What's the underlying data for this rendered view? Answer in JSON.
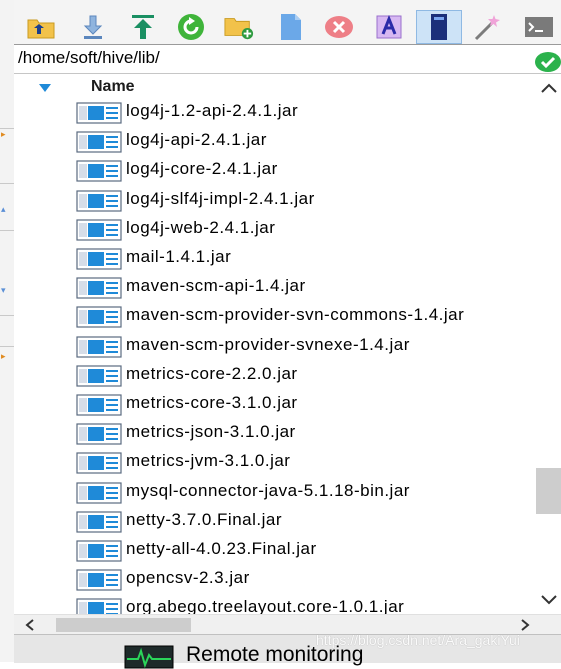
{
  "toolbar": {
    "buttons": [
      {
        "name": "parent-folder-icon"
      },
      {
        "name": "download-icon"
      },
      {
        "name": "upload-icon"
      },
      {
        "name": "refresh-icon"
      },
      {
        "name": "new-folder-icon"
      },
      {
        "name": "new-file-icon"
      },
      {
        "name": "delete-icon"
      },
      {
        "name": "rename-icon"
      },
      {
        "name": "view-mode-icon"
      },
      {
        "name": "magic-wand-icon"
      },
      {
        "name": "terminal-icon"
      }
    ]
  },
  "pathbar": {
    "path": "/home/soft/hive/lib/"
  },
  "list": {
    "column_name": "Name",
    "files": [
      "log4j-1.2-api-2.4.1.jar",
      "log4j-api-2.4.1.jar",
      "log4j-core-2.4.1.jar",
      "log4j-slf4j-impl-2.4.1.jar",
      "log4j-web-2.4.1.jar",
      "mail-1.4.1.jar",
      "maven-scm-api-1.4.jar",
      "maven-scm-provider-svn-commons-1.4.jar",
      "maven-scm-provider-svnexe-1.4.jar",
      "metrics-core-2.2.0.jar",
      "metrics-core-3.1.0.jar",
      "metrics-json-3.1.0.jar",
      "metrics-jvm-3.1.0.jar",
      "mysql-connector-java-5.1.18-bin.jar",
      "netty-3.7.0.Final.jar",
      "netty-all-4.0.23.Final.jar",
      "opencsv-2.3.jar",
      "org.abego.treelayout.core-1.0.1.jar"
    ]
  },
  "bottom": {
    "monitor_label": "Remote monitoring"
  },
  "watermark": "https://blog.csdn.net/Ara_gakiYui",
  "colors": {
    "accent_blue": "#1f8ad8",
    "ok_green": "#2bb24c",
    "delete_red": "#e8626b",
    "folder_yellow": "#f2c24a"
  }
}
